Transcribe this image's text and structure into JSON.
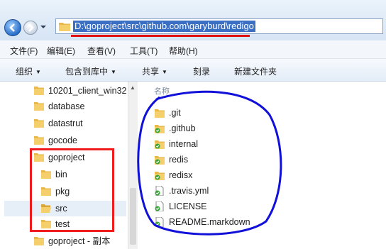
{
  "address": {
    "path": "D:\\goproject\\src\\github.com\\garyburd\\redigo"
  },
  "menu": [
    "文件(F)",
    "编辑(E)",
    "查看(V)",
    "工具(T)",
    "帮助(H)"
  ],
  "toolbar": [
    "组织",
    "包含到库中",
    "共享",
    "刻录",
    "新建文件夹"
  ],
  "tree": [
    "10201_client_win32",
    "database",
    "datastrut",
    "gocode",
    "goproject",
    "bin",
    "pkg",
    "src",
    "test",
    "goproject - 副本"
  ],
  "column_header": "名称",
  "files": [
    {
      "name": ".git",
      "icon": "folder-icon"
    },
    {
      "name": ".github",
      "icon": "folder-synced-icon"
    },
    {
      "name": "internal",
      "icon": "folder-synced-icon"
    },
    {
      "name": "redis",
      "icon": "folder-synced-icon"
    },
    {
      "name": "redisx",
      "icon": "folder-synced-icon"
    },
    {
      "name": ".travis.yml",
      "icon": "file-synced-icon"
    },
    {
      "name": "LICENSE",
      "icon": "file-synced-icon"
    },
    {
      "name": "README.markdown",
      "icon": "file-synced-icon"
    }
  ],
  "colors": {
    "highlight_box": "#ee1c1c",
    "annotation_ring": "#1010d8",
    "folder": "#e8b84a",
    "sync_badge": "#3aa33a"
  }
}
